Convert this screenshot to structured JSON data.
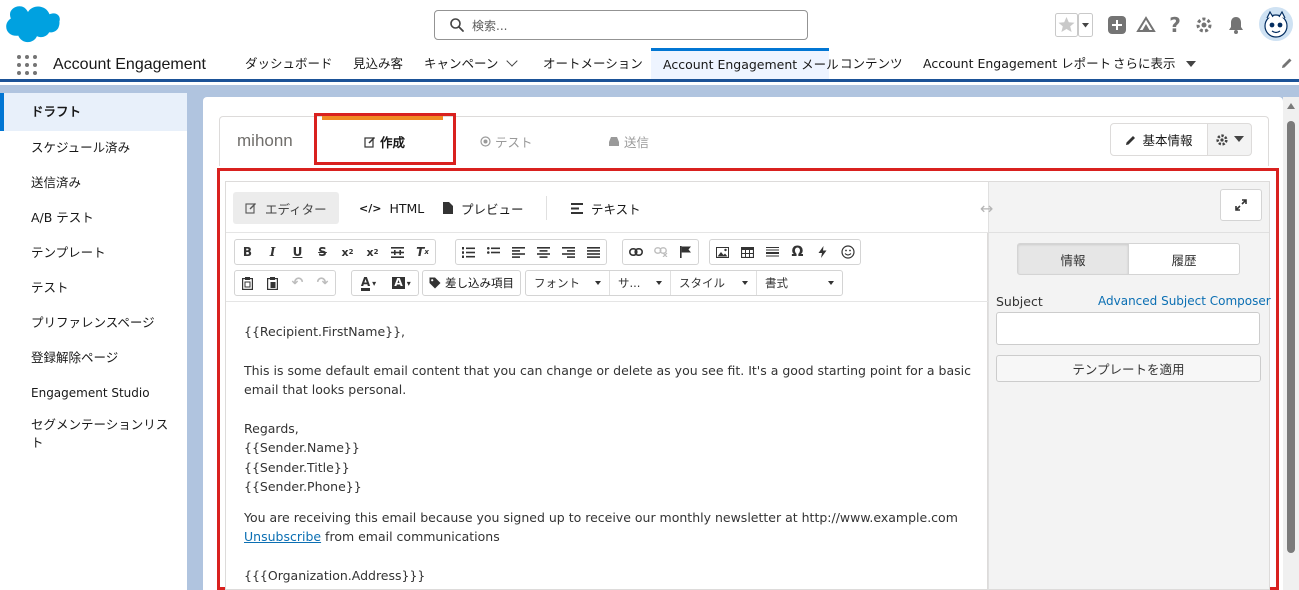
{
  "header": {
    "search_placeholder": "検索...",
    "icons": [
      "salesforce-cloud-logo",
      "favorites-star",
      "add-icon",
      "trailhead-icon",
      "help-icon",
      "setup-gear-icon",
      "notifications-bell-icon",
      "user-avatar"
    ]
  },
  "nav": {
    "app_name": "Account Engagement",
    "items": [
      {
        "label": "ダッシュボード"
      },
      {
        "label": "見込み客"
      },
      {
        "label": "キャンペーン"
      },
      {
        "label": "オートメーション"
      },
      {
        "label": "Account Engagement メール"
      },
      {
        "label": "コンテンツ"
      },
      {
        "label": "Account Engagement レポート"
      },
      {
        "label": "さらに表示"
      }
    ],
    "active": "Account Engagement メール"
  },
  "sidebar": {
    "items": [
      {
        "label": "ドラフト"
      },
      {
        "label": "スケジュール済み"
      },
      {
        "label": "送信済み"
      },
      {
        "label": "A/B テスト"
      },
      {
        "label": "テンプレート"
      },
      {
        "label": "テスト"
      },
      {
        "label": "プリファレンスページ"
      },
      {
        "label": "登録解除ページ"
      },
      {
        "label": "Engagement Studio"
      },
      {
        "label": "セグメンテーションリスト"
      }
    ],
    "active": "ドラフト"
  },
  "email": {
    "name": "mihonn",
    "wizard_tabs": [
      {
        "label": "作成"
      },
      {
        "label": "テスト"
      },
      {
        "label": "送信"
      }
    ],
    "basic_info_label": "基本情報"
  },
  "editor": {
    "tabs": [
      {
        "label": "エディター"
      },
      {
        "label": "HTML"
      },
      {
        "label": "プレビュー"
      },
      {
        "label": "テキスト"
      }
    ],
    "toolbar": {
      "merge_fields": "差し込み項目",
      "font": "フォント",
      "size": "サ...",
      "style": "スタイル",
      "format": "書式"
    },
    "content": {
      "greeting": "{{Recipient.FirstName}},",
      "body": "This is some default email content that you can change or delete as you see fit. It's a good starting point for a basic email that looks personal.",
      "regards": "Regards,",
      "sender_name": "{{Sender.Name}}",
      "sender_title": "{{Sender.Title}}",
      "sender_phone": "{{Sender.Phone}}",
      "footer": "You are receiving this email because you signed up to receive our monthly newsletter at http://www.example.com",
      "unsubscribe_link": "Unsubscribe",
      "unsubscribe_rest": " from email communications",
      "org_address": "{{{Organization.Address}}}"
    }
  },
  "right_panel": {
    "seg_info": "情報",
    "seg_history": "履歴",
    "subject_label": "Subject",
    "subject_composer_link": "Advanced Subject Composer",
    "subject_value": "",
    "apply_template": "テンプレートを適用"
  },
  "colors": {
    "brand_blue": "#0176d3",
    "nav_underline": "#1b5297",
    "background_band": "#b0c4df",
    "highlight_red": "#d9211f",
    "active_tab_orange": "#f08a24"
  }
}
